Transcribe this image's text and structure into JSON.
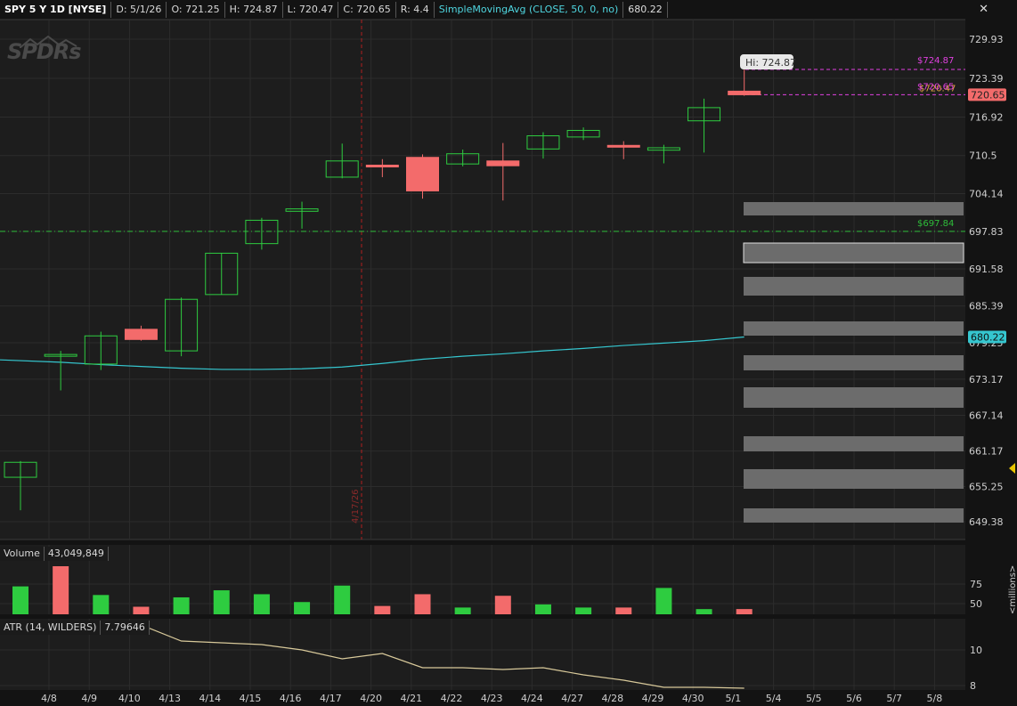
{
  "header": {
    "symbol": "SPY 5 Y 1D [NYSE]",
    "date": "D: 5/1/26",
    "open": "O: 721.25",
    "high": "H: 724.87",
    "low": "L: 720.47",
    "close": "C: 720.65",
    "range": "R: 4.4",
    "study": "SimpleMovingAvg (CLOSE, 50, 0, no)",
    "study_value": "680.22"
  },
  "logo_text": "SPDRs",
  "annotations": {
    "hi_bubble": "Hi: 724.87",
    "hi_line_label": "$724.87",
    "close_line_label": "$720.65",
    "close_line_label2": "$720.47",
    "level_label": "$697.84",
    "last_price_tag": "720.65",
    "sma_price_tag": "680.22",
    "vertical_marker_label": "4/17/26"
  },
  "volume_panel": {
    "label": "Volume",
    "value": "43,049,849",
    "axis_unit": "<millions>"
  },
  "atr_panel": {
    "label": "ATR (14, WILDERS)",
    "value": "7.79646"
  },
  "colors": {
    "up": "#2ecc40",
    "down": "#f36b6b",
    "sma": "#35c6cf",
    "atr": "#d8c99a",
    "grid": "#2c2c2c",
    "magenta": "#e040e0",
    "green_level": "#2ebd3a"
  },
  "chart_data": {
    "type": "candlestick",
    "title": "SPY 5 Y 1D [NYSE]",
    "price_axis_ticks": [
      "729.93",
      "723.39",
      "716.92",
      "710.5",
      "704.14",
      "697.83",
      "691.58",
      "685.39",
      "679.25",
      "673.17",
      "667.14",
      "661.17",
      "655.25",
      "649.38"
    ],
    "x_tick_labels": [
      "4/8",
      "4/9",
      "4/10",
      "4/13",
      "4/14",
      "4/15",
      "4/16",
      "4/17",
      "4/20",
      "4/21",
      "4/22",
      "4/23",
      "4/24",
      "4/27",
      "4/28",
      "4/29",
      "4/30",
      "5/1",
      "5/4",
      "5/5",
      "5/6",
      "5/7",
      "5/8"
    ],
    "candles": [
      {
        "date": "4/7",
        "o": 656.8,
        "h": 659.5,
        "l": 651.3,
        "c": 659.3
      },
      {
        "date": "4/8",
        "o": 677.0,
        "h": 677.9,
        "l": 671.3,
        "c": 677.3
      },
      {
        "date": "4/9",
        "o": 675.7,
        "h": 681.1,
        "l": 674.7,
        "c": 680.4
      },
      {
        "date": "4/10",
        "o": 681.5,
        "h": 682.1,
        "l": 679.6,
        "c": 679.8
      },
      {
        "date": "4/13",
        "o": 677.9,
        "h": 686.8,
        "l": 677.0,
        "c": 686.5
      },
      {
        "date": "4/14",
        "o": 687.3,
        "h": 694.2,
        "l": 687.3,
        "c": 694.2
      },
      {
        "date": "4/15",
        "o": 695.8,
        "h": 700.1,
        "l": 694.8,
        "c": 699.7
      },
      {
        "date": "4/16",
        "o": 701.2,
        "h": 702.8,
        "l": 698.3,
        "c": 701.6
      },
      {
        "date": "4/17",
        "o": 706.9,
        "h": 712.5,
        "l": 706.7,
        "c": 709.6
      },
      {
        "date": "4/20",
        "o": 708.9,
        "h": 709.9,
        "l": 706.9,
        "c": 708.6
      },
      {
        "date": "4/21",
        "o": 710.2,
        "h": 710.7,
        "l": 703.3,
        "c": 704.6
      },
      {
        "date": "4/22",
        "o": 709.1,
        "h": 711.5,
        "l": 708.7,
        "c": 710.8
      },
      {
        "date": "4/23",
        "o": 709.6,
        "h": 712.6,
        "l": 703.0,
        "c": 708.8
      },
      {
        "date": "4/24",
        "o": 711.6,
        "h": 714.4,
        "l": 710.0,
        "c": 713.8
      },
      {
        "date": "4/27",
        "o": 713.6,
        "h": 715.2,
        "l": 713.1,
        "c": 714.7
      },
      {
        "date": "4/28",
        "o": 712.2,
        "h": 712.9,
        "l": 709.9,
        "c": 711.9
      },
      {
        "date": "4/29",
        "o": 711.4,
        "h": 712.3,
        "l": 709.2,
        "c": 711.8
      },
      {
        "date": "4/30",
        "o": 716.3,
        "h": 720.0,
        "l": 711.0,
        "c": 718.5
      },
      {
        "date": "5/1",
        "o": 721.25,
        "h": 724.87,
        "l": 720.47,
        "c": 720.65
      }
    ],
    "sma50": [
      676.4,
      676.0,
      675.6,
      675.3,
      675.0,
      674.8,
      674.8,
      674.9,
      675.2,
      675.8,
      676.5,
      677.0,
      677.4,
      677.9,
      678.3,
      678.8,
      679.2,
      679.6,
      680.22
    ],
    "volume_ticks": [
      "75",
      "50"
    ],
    "volume_millions": [
      72,
      99,
      61,
      46,
      58,
      67,
      62,
      52,
      73,
      47,
      62,
      45,
      60,
      49,
      45,
      45,
      70,
      43,
      43.05
    ],
    "volume_up": [
      true,
      false,
      true,
      false,
      true,
      true,
      true,
      true,
      true,
      false,
      false,
      true,
      false,
      true,
      true,
      false,
      true,
      true,
      false
    ],
    "volume_dates": [
      "4/7",
      "4/8",
      "4/9",
      "4/10",
      "4/13",
      "4/14",
      "4/15",
      "4/16",
      "4/17",
      "4/20",
      "4/21",
      "4/22",
      "4/23",
      "4/24",
      "4/27",
      "4/28",
      "4/29",
      "4/30",
      "5/1"
    ],
    "atr_ticks": [
      "10",
      "8"
    ],
    "atr": [
      11.3,
      11.0,
      11.6,
      11.4,
      10.5,
      10.4,
      10.3,
      10.0,
      9.5,
      9.8,
      9.0,
      9.0,
      8.9,
      9.0,
      8.6,
      8.3,
      7.9,
      7.9,
      7.79646
    ]
  }
}
